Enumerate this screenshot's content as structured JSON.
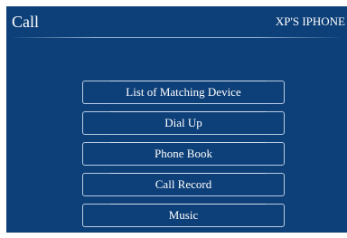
{
  "header": {
    "title": "Call",
    "device_name": "XP'S IPHONE"
  },
  "menu": {
    "items": [
      {
        "label": "List of Matching Device"
      },
      {
        "label": "Dial Up"
      },
      {
        "label": "Phone Book"
      },
      {
        "label": "Call Record"
      },
      {
        "label": "Music"
      }
    ]
  },
  "colors": {
    "background": "#0d3f78",
    "text": "#ffffff",
    "button_border": "#b9cde2"
  }
}
